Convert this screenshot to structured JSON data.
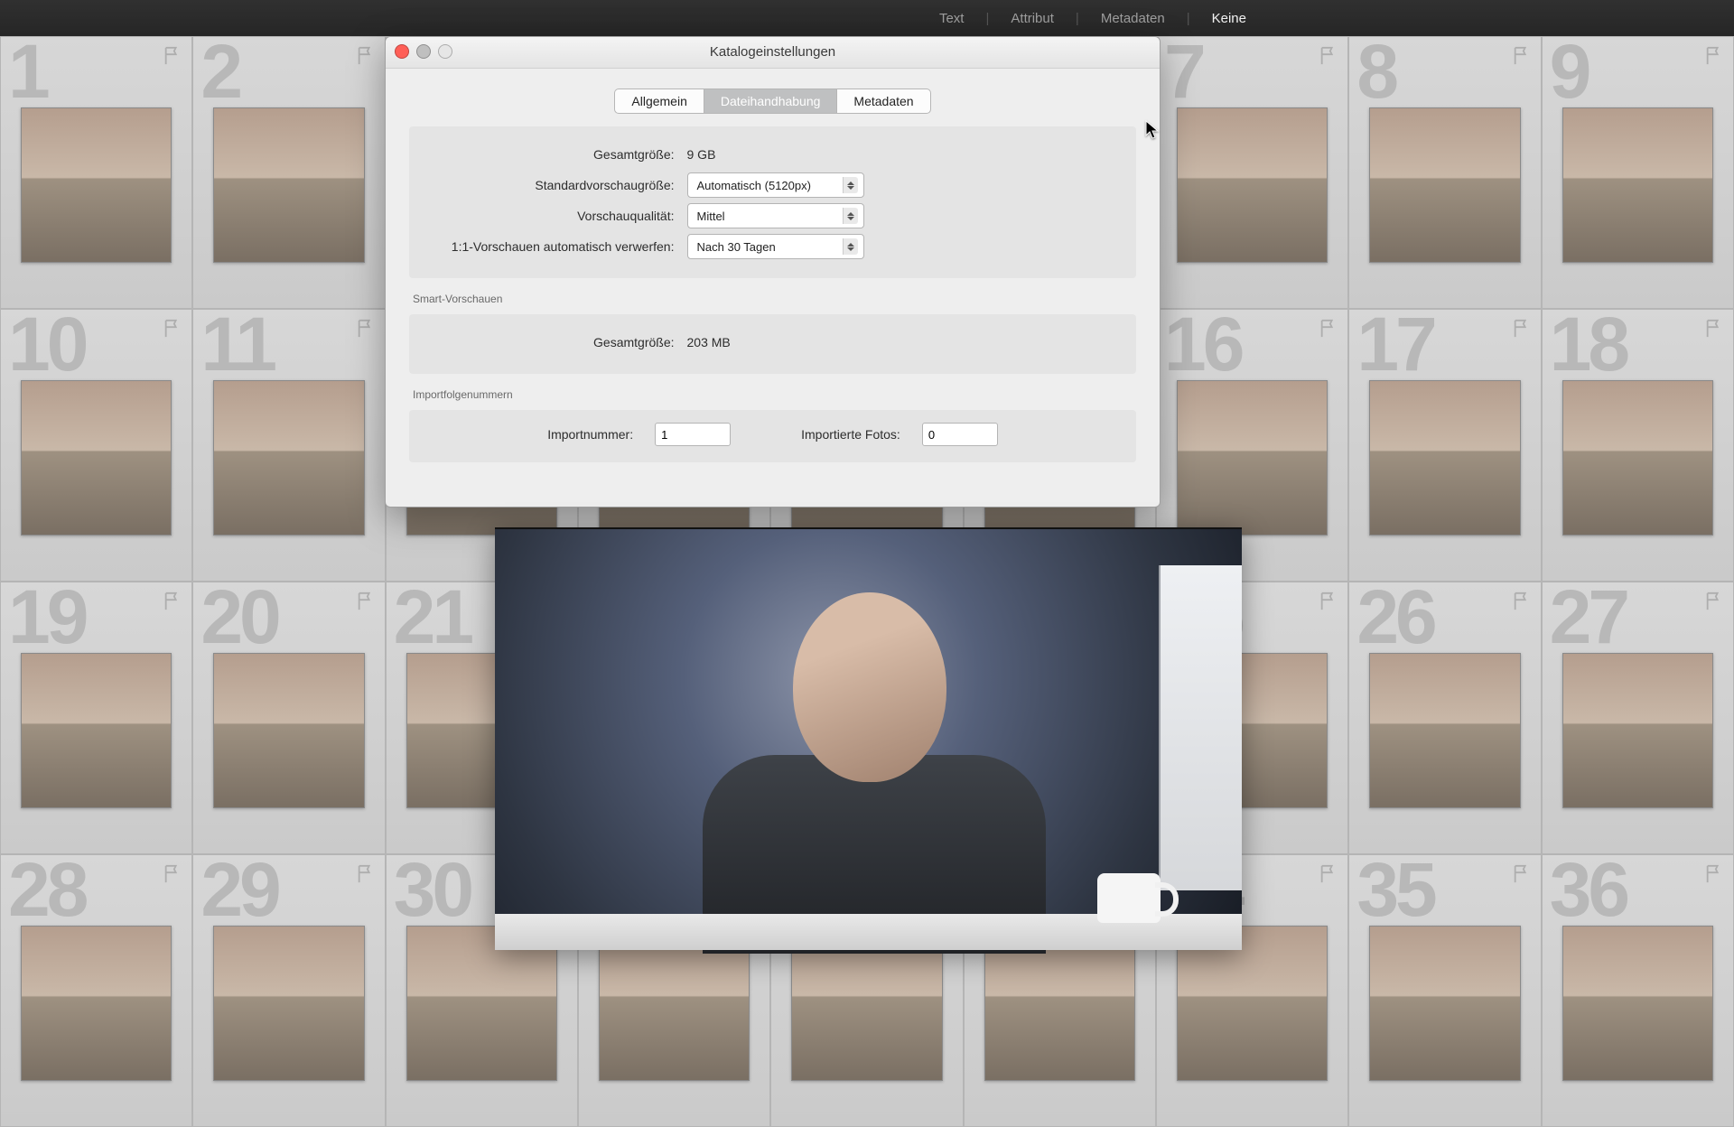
{
  "filterbar": {
    "items": [
      "Text",
      "Attribut",
      "Metadaten",
      "Keine"
    ],
    "active_index": 3
  },
  "grid": {
    "start_number": 1,
    "count": 36
  },
  "dialog": {
    "title": "Katalogeinstellungen",
    "tabs": {
      "items": [
        "Allgemein",
        "Dateihandhabung",
        "Metadaten"
      ],
      "active_index": 1
    },
    "previews": {
      "total_size_label": "Gesamtgröße:",
      "total_size_value": "9 GB",
      "std_preview_label": "Standardvorschaugröße:",
      "std_preview_value": "Automatisch (5120px)",
      "quality_label": "Vorschauqualität:",
      "quality_value": "Mittel",
      "discard_label": "1:1-Vorschauen automatisch verwerfen:",
      "discard_value": "Nach 30 Tagen"
    },
    "smart_previews": {
      "section_label": "Smart-Vorschauen",
      "total_size_label": "Gesamtgröße:",
      "total_size_value": "203 MB"
    },
    "import_numbers": {
      "section_label": "Importfolgenummern",
      "import_number_label": "Importnummer:",
      "import_number_value": "1",
      "imported_photos_label": "Importierte Fotos:",
      "imported_photos_value": "0"
    }
  }
}
